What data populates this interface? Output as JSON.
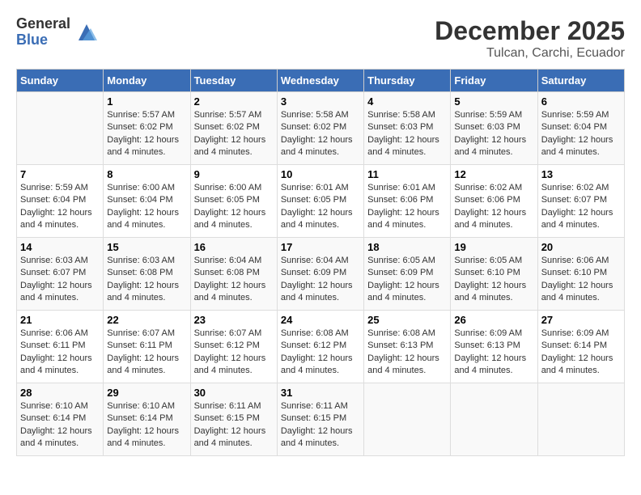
{
  "header": {
    "logo_general": "General",
    "logo_blue": "Blue",
    "month_title": "December 2025",
    "subtitle": "Tulcan, Carchi, Ecuador"
  },
  "weekdays": [
    "Sunday",
    "Monday",
    "Tuesday",
    "Wednesday",
    "Thursday",
    "Friday",
    "Saturday"
  ],
  "weeks": [
    [
      {
        "day": "",
        "info": ""
      },
      {
        "day": "1",
        "info": "Sunrise: 5:57 AM\nSunset: 6:02 PM\nDaylight: 12 hours\nand 4 minutes."
      },
      {
        "day": "2",
        "info": "Sunrise: 5:57 AM\nSunset: 6:02 PM\nDaylight: 12 hours\nand 4 minutes."
      },
      {
        "day": "3",
        "info": "Sunrise: 5:58 AM\nSunset: 6:02 PM\nDaylight: 12 hours\nand 4 minutes."
      },
      {
        "day": "4",
        "info": "Sunrise: 5:58 AM\nSunset: 6:03 PM\nDaylight: 12 hours\nand 4 minutes."
      },
      {
        "day": "5",
        "info": "Sunrise: 5:59 AM\nSunset: 6:03 PM\nDaylight: 12 hours\nand 4 minutes."
      },
      {
        "day": "6",
        "info": "Sunrise: 5:59 AM\nSunset: 6:04 PM\nDaylight: 12 hours\nand 4 minutes."
      }
    ],
    [
      {
        "day": "7",
        "info": "Sunrise: 5:59 AM\nSunset: 6:04 PM\nDaylight: 12 hours\nand 4 minutes."
      },
      {
        "day": "8",
        "info": "Sunrise: 6:00 AM\nSunset: 6:04 PM\nDaylight: 12 hours\nand 4 minutes."
      },
      {
        "day": "9",
        "info": "Sunrise: 6:00 AM\nSunset: 6:05 PM\nDaylight: 12 hours\nand 4 minutes."
      },
      {
        "day": "10",
        "info": "Sunrise: 6:01 AM\nSunset: 6:05 PM\nDaylight: 12 hours\nand 4 minutes."
      },
      {
        "day": "11",
        "info": "Sunrise: 6:01 AM\nSunset: 6:06 PM\nDaylight: 12 hours\nand 4 minutes."
      },
      {
        "day": "12",
        "info": "Sunrise: 6:02 AM\nSunset: 6:06 PM\nDaylight: 12 hours\nand 4 minutes."
      },
      {
        "day": "13",
        "info": "Sunrise: 6:02 AM\nSunset: 6:07 PM\nDaylight: 12 hours\nand 4 minutes."
      }
    ],
    [
      {
        "day": "14",
        "info": "Sunrise: 6:03 AM\nSunset: 6:07 PM\nDaylight: 12 hours\nand 4 minutes."
      },
      {
        "day": "15",
        "info": "Sunrise: 6:03 AM\nSunset: 6:08 PM\nDaylight: 12 hours\nand 4 minutes."
      },
      {
        "day": "16",
        "info": "Sunrise: 6:04 AM\nSunset: 6:08 PM\nDaylight: 12 hours\nand 4 minutes."
      },
      {
        "day": "17",
        "info": "Sunrise: 6:04 AM\nSunset: 6:09 PM\nDaylight: 12 hours\nand 4 minutes."
      },
      {
        "day": "18",
        "info": "Sunrise: 6:05 AM\nSunset: 6:09 PM\nDaylight: 12 hours\nand 4 minutes."
      },
      {
        "day": "19",
        "info": "Sunrise: 6:05 AM\nSunset: 6:10 PM\nDaylight: 12 hours\nand 4 minutes."
      },
      {
        "day": "20",
        "info": "Sunrise: 6:06 AM\nSunset: 6:10 PM\nDaylight: 12 hours\nand 4 minutes."
      }
    ],
    [
      {
        "day": "21",
        "info": "Sunrise: 6:06 AM\nSunset: 6:11 PM\nDaylight: 12 hours\nand 4 minutes."
      },
      {
        "day": "22",
        "info": "Sunrise: 6:07 AM\nSunset: 6:11 PM\nDaylight: 12 hours\nand 4 minutes."
      },
      {
        "day": "23",
        "info": "Sunrise: 6:07 AM\nSunset: 6:12 PM\nDaylight: 12 hours\nand 4 minutes."
      },
      {
        "day": "24",
        "info": "Sunrise: 6:08 AM\nSunset: 6:12 PM\nDaylight: 12 hours\nand 4 minutes."
      },
      {
        "day": "25",
        "info": "Sunrise: 6:08 AM\nSunset: 6:13 PM\nDaylight: 12 hours\nand 4 minutes."
      },
      {
        "day": "26",
        "info": "Sunrise: 6:09 AM\nSunset: 6:13 PM\nDaylight: 12 hours\nand 4 minutes."
      },
      {
        "day": "27",
        "info": "Sunrise: 6:09 AM\nSunset: 6:14 PM\nDaylight: 12 hours\nand 4 minutes."
      }
    ],
    [
      {
        "day": "28",
        "info": "Sunrise: 6:10 AM\nSunset: 6:14 PM\nDaylight: 12 hours\nand 4 minutes."
      },
      {
        "day": "29",
        "info": "Sunrise: 6:10 AM\nSunset: 6:14 PM\nDaylight: 12 hours\nand 4 minutes."
      },
      {
        "day": "30",
        "info": "Sunrise: 6:11 AM\nSunset: 6:15 PM\nDaylight: 12 hours\nand 4 minutes."
      },
      {
        "day": "31",
        "info": "Sunrise: 6:11 AM\nSunset: 6:15 PM\nDaylight: 12 hours\nand 4 minutes."
      },
      {
        "day": "",
        "info": ""
      },
      {
        "day": "",
        "info": ""
      },
      {
        "day": "",
        "info": ""
      }
    ]
  ]
}
